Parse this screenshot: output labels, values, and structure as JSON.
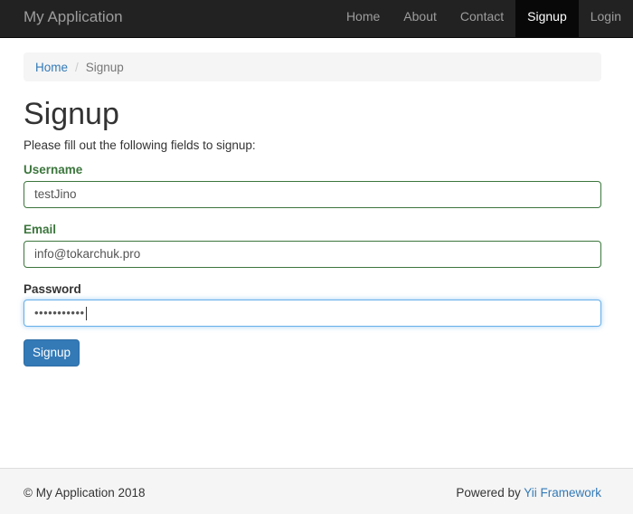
{
  "navbar": {
    "brand": "My Application",
    "items": [
      {
        "label": "Home",
        "active": false
      },
      {
        "label": "About",
        "active": false
      },
      {
        "label": "Contact",
        "active": false
      },
      {
        "label": "Signup",
        "active": true
      },
      {
        "label": "Login",
        "active": false
      }
    ]
  },
  "breadcrumb": {
    "home": "Home",
    "separator": "/",
    "current": "Signup"
  },
  "main": {
    "title": "Signup",
    "intro": "Please fill out the following fields to signup:",
    "fields": {
      "username": {
        "label": "Username",
        "value": "testJino",
        "state": "success"
      },
      "email": {
        "label": "Email",
        "value": "info@tokarchuk.pro",
        "state": "success"
      },
      "password": {
        "label": "Password",
        "value": "•••••••••••",
        "state": "focused"
      }
    },
    "submit_label": "Signup"
  },
  "footer": {
    "copyright": "© My Application 2018",
    "powered_prefix": "Powered by ",
    "powered_link": "Yii Framework"
  },
  "colors": {
    "navbar_bg": "#222222",
    "active_nav_bg": "#080808",
    "link": "#337ab7",
    "success": "#3c763d",
    "focus_border": "#66afe9",
    "primary_button": "#337ab7"
  }
}
